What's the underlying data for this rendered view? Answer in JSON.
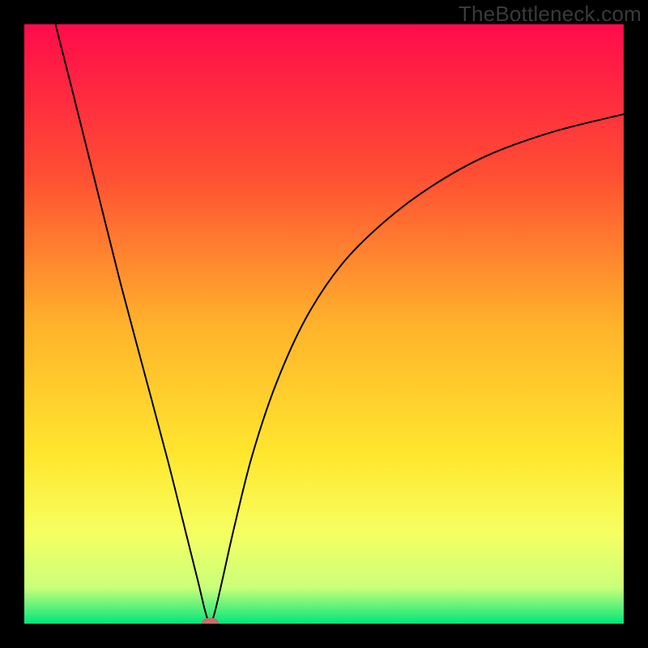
{
  "attribution": "TheBottleneck.com",
  "chart_data": {
    "type": "line",
    "title": "",
    "xlabel": "",
    "ylabel": "",
    "xlim": [
      0,
      100
    ],
    "ylim": [
      0,
      100
    ],
    "gradient_stops": [
      {
        "offset": 0,
        "color": "#ff0b4b"
      },
      {
        "offset": 25,
        "color": "#ff4e33"
      },
      {
        "offset": 50,
        "color": "#ffb22b"
      },
      {
        "offset": 72,
        "color": "#ffe72e"
      },
      {
        "offset": 85,
        "color": "#f6ff62"
      },
      {
        "offset": 94,
        "color": "#c9ff7a"
      },
      {
        "offset": 100,
        "color": "#00e67a"
      }
    ],
    "curve": {
      "minimum_x": 31,
      "points": [
        {
          "x": 5.2,
          "y": 100
        },
        {
          "x": 8,
          "y": 89
        },
        {
          "x": 12,
          "y": 73
        },
        {
          "x": 16,
          "y": 57
        },
        {
          "x": 20,
          "y": 42
        },
        {
          "x": 24,
          "y": 27
        },
        {
          "x": 27,
          "y": 15
        },
        {
          "x": 29,
          "y": 7
        },
        {
          "x": 30.2,
          "y": 2
        },
        {
          "x": 31,
          "y": 0
        },
        {
          "x": 31.8,
          "y": 2
        },
        {
          "x": 33.2,
          "y": 8
        },
        {
          "x": 35,
          "y": 16
        },
        {
          "x": 38,
          "y": 28
        },
        {
          "x": 42,
          "y": 40
        },
        {
          "x": 47,
          "y": 51
        },
        {
          "x": 53,
          "y": 60
        },
        {
          "x": 60,
          "y": 67
        },
        {
          "x": 68,
          "y": 73
        },
        {
          "x": 77,
          "y": 78
        },
        {
          "x": 88,
          "y": 82
        },
        {
          "x": 100,
          "y": 85
        }
      ]
    },
    "marker": {
      "x": 31,
      "y": 0,
      "rx": 1.5,
      "ry": 1.0,
      "color": "#c96b6b"
    }
  }
}
